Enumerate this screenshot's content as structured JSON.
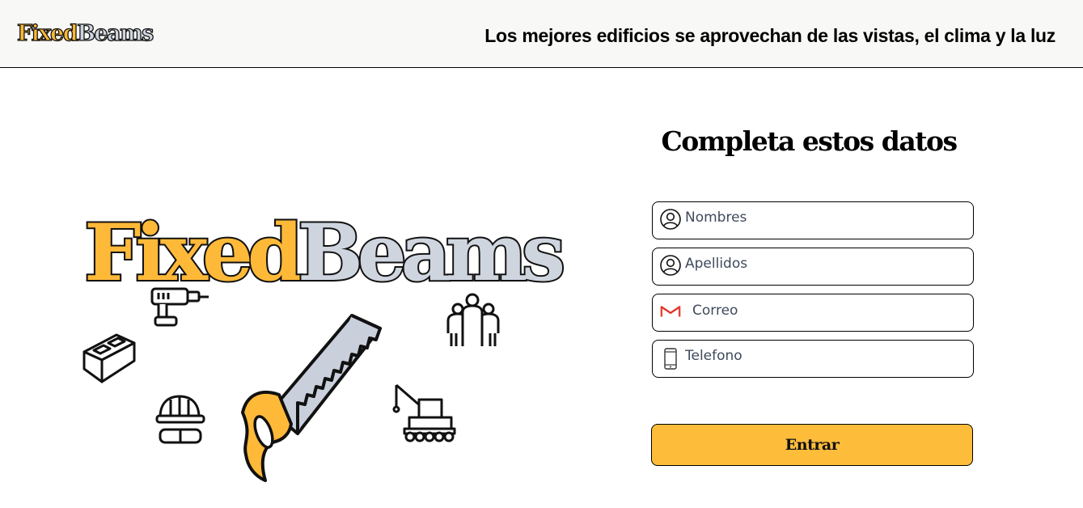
{
  "header": {
    "logo": {
      "part1": "Fixed",
      "part2": "Beams"
    },
    "tagline": "Los mejores edificios se aprovechan de las vistas, el clima y la luz"
  },
  "hero": {
    "logo": {
      "part1": "Fixed",
      "part2": "Beams"
    }
  },
  "form": {
    "title": "Completa estos datos",
    "fields": [
      {
        "placeholder": "Nombres",
        "icon": "user-icon"
      },
      {
        "placeholder": "Apellidos",
        "icon": "user-icon"
      },
      {
        "placeholder": "Correo",
        "icon": "gmail-icon"
      },
      {
        "placeholder": "Telefono",
        "icon": "phone-icon"
      }
    ],
    "submit_label": "Entrar"
  },
  "colors": {
    "brand_yellow": "#fdbd3b",
    "brand_grey": "#cfd5df",
    "header_bg": "#f8f8f6",
    "gmail_red": "#ea4335"
  }
}
